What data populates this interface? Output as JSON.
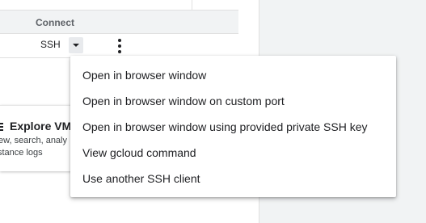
{
  "table": {
    "header": {
      "connect_label": "Connect"
    },
    "row": {
      "ssh_label": "SSH",
      "dropdown_icon": "caret-down-icon",
      "more_icon": "more-vertical-icon"
    }
  },
  "explore_card": {
    "icon": "list-icon",
    "title": "Explore VM",
    "description_line1": "ew, search, analy",
    "description_line2": "stance logs"
  },
  "ssh_menu": {
    "items": [
      {
        "label": "Open in browser window"
      },
      {
        "label": "Open in browser window on custom port"
      },
      {
        "label": "Open in browser window using provided private SSH key"
      },
      {
        "label": "View gcloud command"
      },
      {
        "label": "Use another SSH client"
      }
    ]
  },
  "colors": {
    "text": "#202124",
    "header_background": "#f1f3f4",
    "menu_background": "#ffffff",
    "button_background": "#e8eaed"
  }
}
